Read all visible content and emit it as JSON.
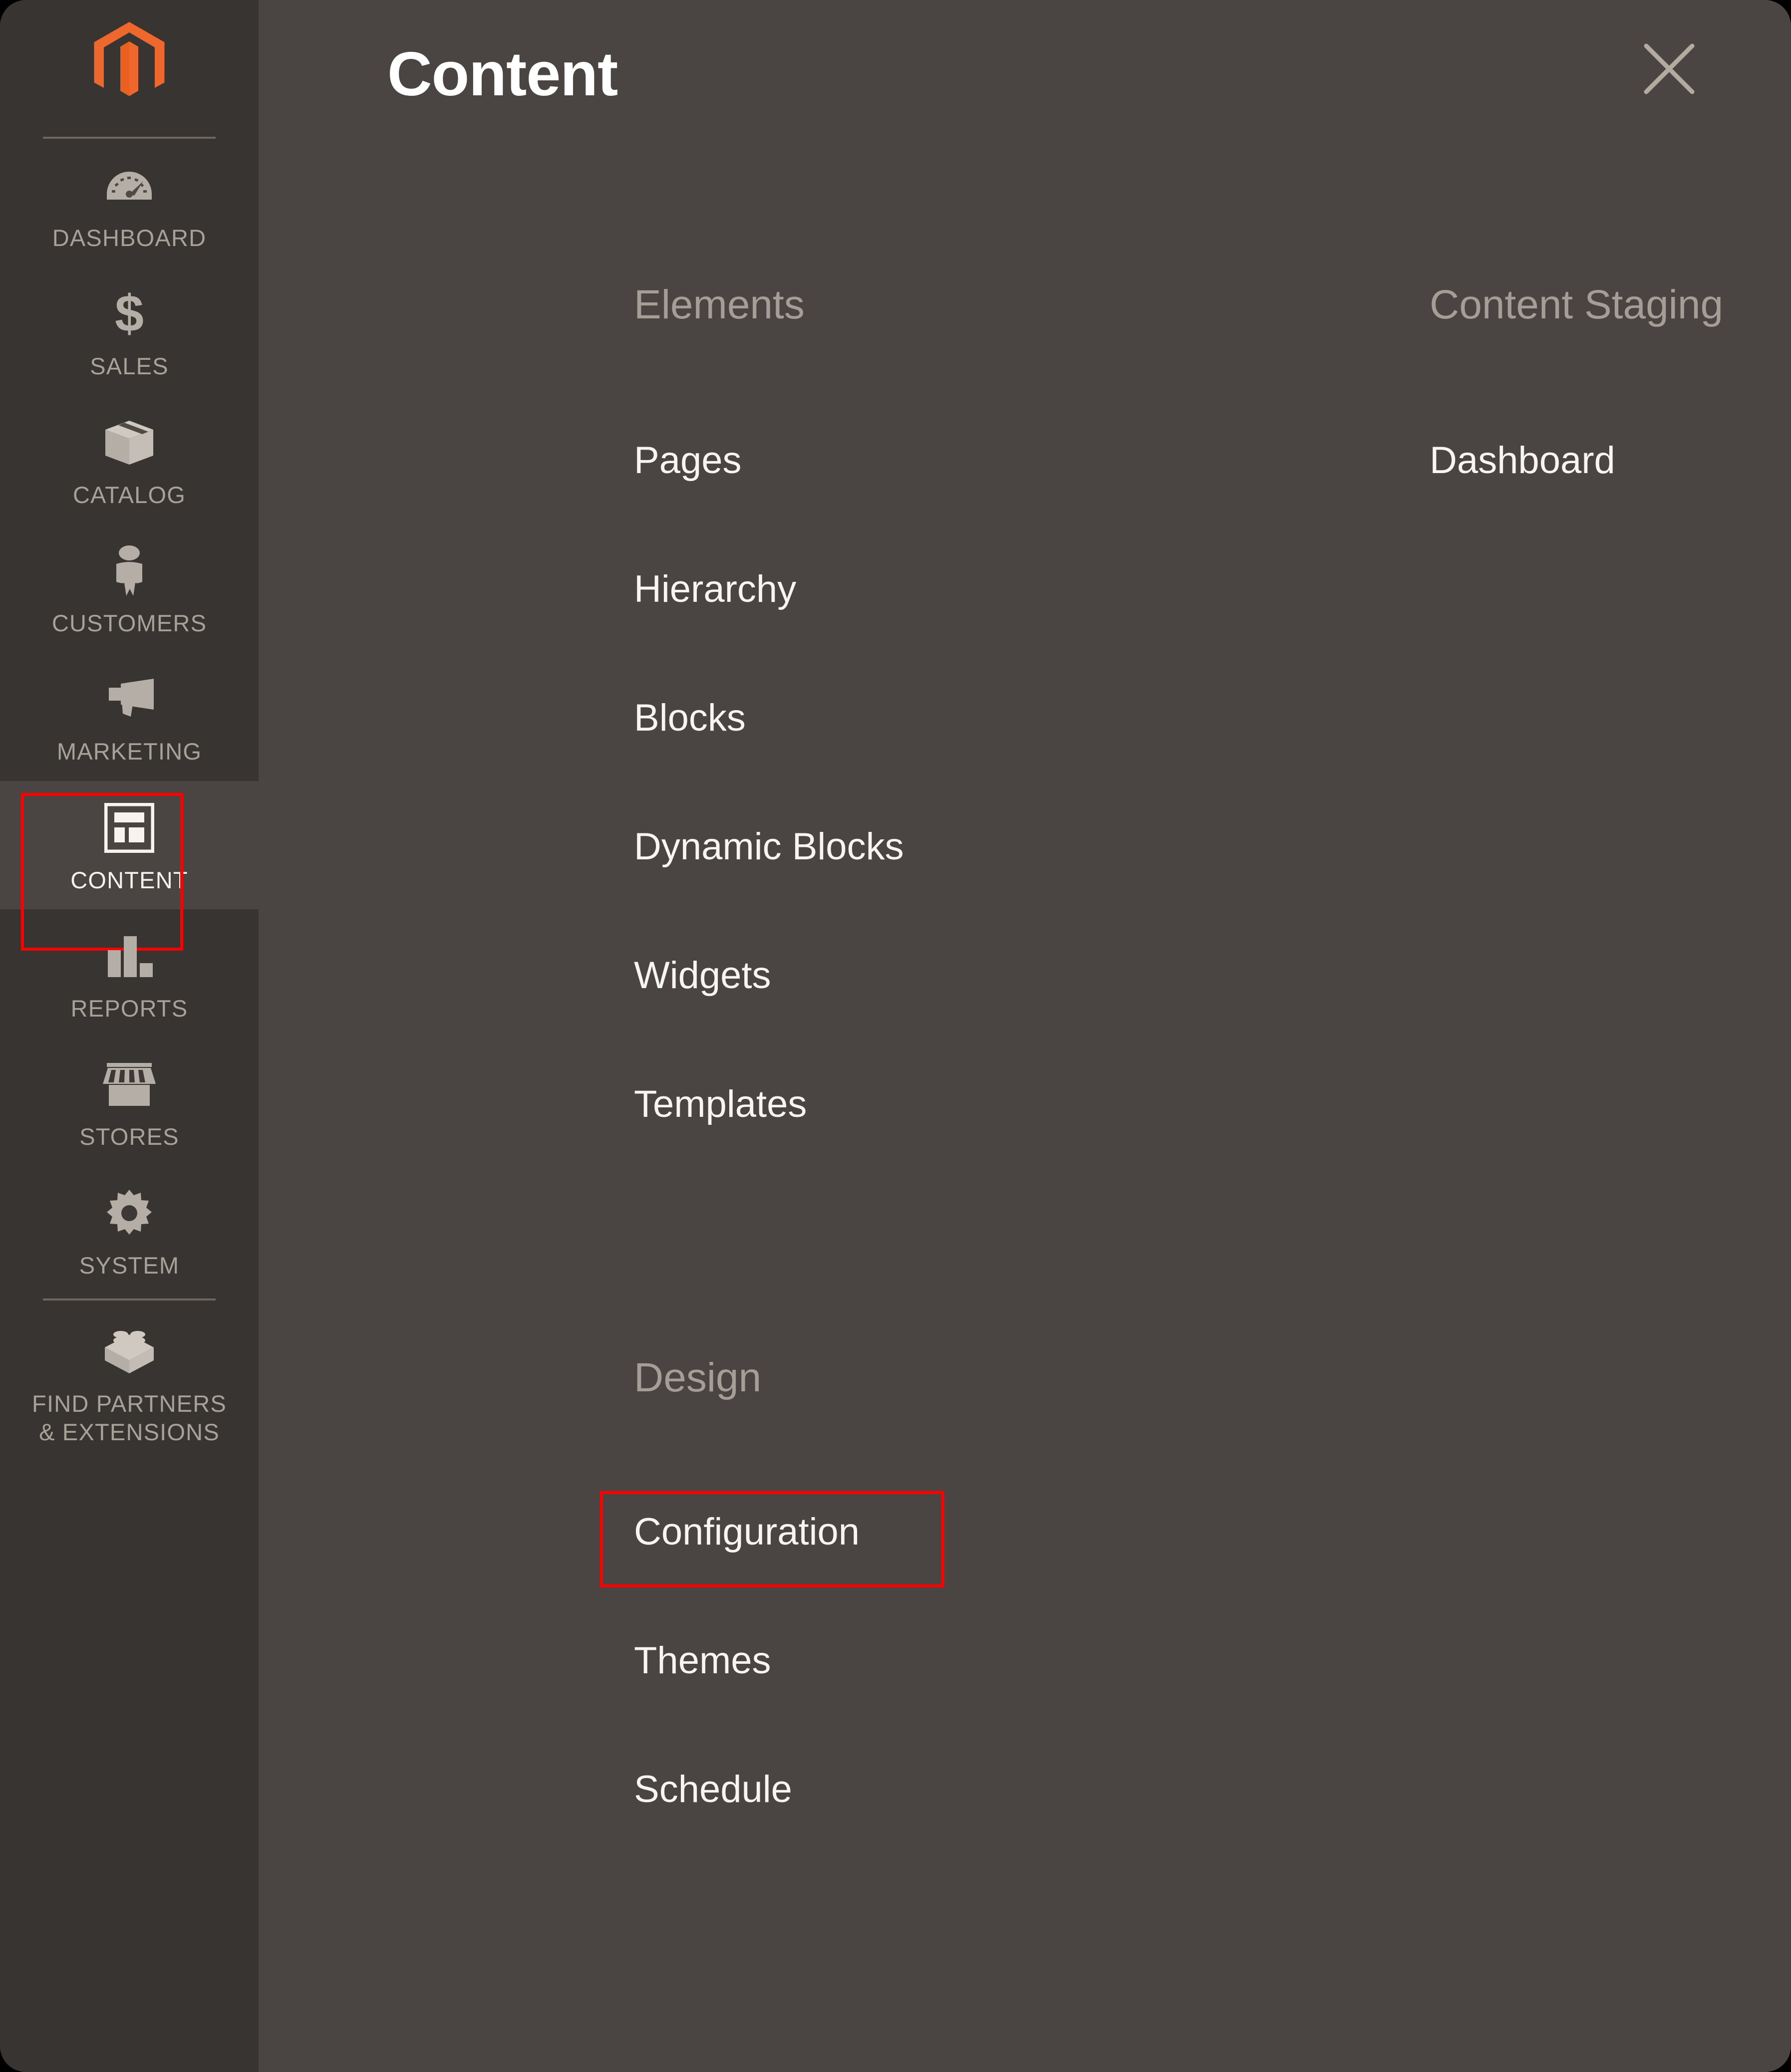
{
  "panel": {
    "title": "Content",
    "close_icon": "close-icon"
  },
  "sidebar": {
    "logo_icon": "magento-logo-icon",
    "items": [
      {
        "label": "DASHBOARD",
        "icon": "gauge-icon",
        "active": false
      },
      {
        "label": "SALES",
        "icon": "dollar-sign-icon",
        "active": false
      },
      {
        "label": "CATALOG",
        "icon": "box-icon",
        "active": false
      },
      {
        "label": "CUSTOMERS",
        "icon": "person-icon",
        "active": false
      },
      {
        "label": "MARKETING",
        "icon": "megaphone-icon",
        "active": false
      },
      {
        "label": "CONTENT",
        "icon": "layout-icon",
        "active": true
      },
      {
        "label": "REPORTS",
        "icon": "bar-chart-icon",
        "active": false
      },
      {
        "label": "STORES",
        "icon": "storefront-icon",
        "active": false
      },
      {
        "label": "SYSTEM",
        "icon": "gear-icon",
        "active": false
      },
      {
        "label": "FIND PARTNERS\n& EXTENSIONS",
        "icon": "lego-brick-icon",
        "active": false
      }
    ]
  },
  "menu": {
    "groups": [
      {
        "title": "Elements",
        "items": [
          {
            "label": "Pages"
          },
          {
            "label": "Hierarchy"
          },
          {
            "label": "Blocks"
          },
          {
            "label": "Dynamic Blocks"
          },
          {
            "label": "Widgets"
          },
          {
            "label": "Templates"
          }
        ]
      },
      {
        "title": "Content Staging",
        "items": [
          {
            "label": "Dashboard"
          }
        ]
      },
      {
        "title": "Design",
        "items": [
          {
            "label": "Configuration",
            "highlighted": true
          },
          {
            "label": "Themes"
          },
          {
            "label": "Schedule"
          }
        ]
      }
    ]
  },
  "colors": {
    "sidebar_bg": "#373431",
    "panel_bg": "#4a4542",
    "brand_orange": "#ee672c",
    "highlight_red": "#ff0000",
    "icon_gray": "#a8a19a",
    "group_title": "#a59d96",
    "item_text": "#f7f5f2"
  }
}
